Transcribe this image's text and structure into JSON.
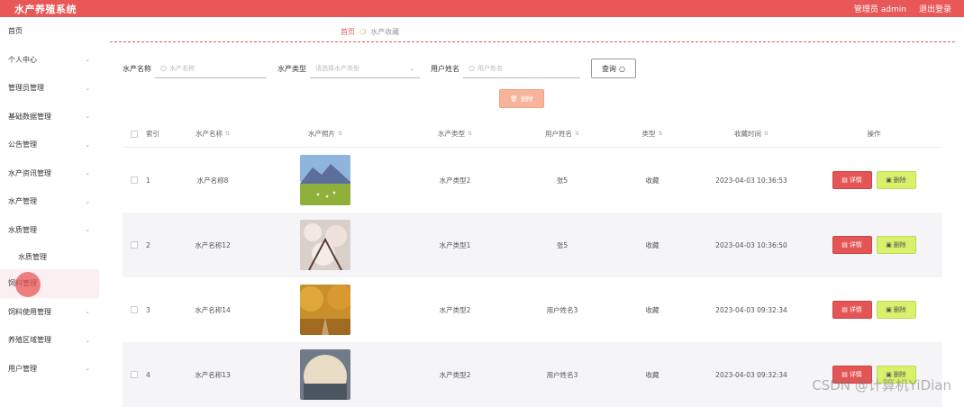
{
  "app": {
    "title": "水产养殖系统",
    "user_label": "管理员 admin",
    "logout_label": "退出登录"
  },
  "sidebar": {
    "items": [
      {
        "label": "首页",
        "chev": false
      },
      {
        "label": "个人中心",
        "chev": true
      },
      {
        "label": "管理员管理",
        "chev": true
      },
      {
        "label": "基础数据管理",
        "chev": true
      },
      {
        "label": "公告管理",
        "chev": true
      },
      {
        "label": "水产资讯管理",
        "chev": true
      },
      {
        "label": "水产管理",
        "chev": true
      },
      {
        "label": "水质管理",
        "chev": true
      },
      {
        "label": "水质管理",
        "chev": false
      },
      {
        "label": "饲料管理",
        "chev": false
      },
      {
        "label": "饲料使用管理",
        "chev": true
      },
      {
        "label": "养殖区域管理",
        "chev": true
      },
      {
        "label": "用户管理",
        "chev": true
      }
    ]
  },
  "breadcrumb": {
    "home": "首页",
    "current": "水产收藏"
  },
  "search": {
    "name_label": "水产名称",
    "name_placeholder": "水产名称",
    "type_label": "水产类型",
    "type_placeholder": "请选择水产类型",
    "user_label": "用户姓名",
    "user_placeholder": "用户姓名",
    "button_label": "查询"
  },
  "toolbar": {
    "delete_label": "删除"
  },
  "table": {
    "columns": [
      "索引",
      "水产名称",
      "水产照片",
      "水产类型",
      "用户姓名",
      "类型",
      "收藏时间",
      "操作"
    ],
    "detail_label": "详情",
    "delete_label": "删除",
    "rows": [
      {
        "index": "1",
        "name": "水产名称8",
        "type": "水产类型2",
        "user": "张5",
        "kind": "收藏",
        "time": "2023-04-03 10:36:53",
        "photo": "mountain-meadow"
      },
      {
        "index": "2",
        "name": "水产名称12",
        "type": "水产类型1",
        "user": "张5",
        "kind": "收藏",
        "time": "2023-04-03 10:36:50",
        "photo": "cherry-blossom"
      },
      {
        "index": "3",
        "name": "水产名称14",
        "type": "水产类型2",
        "user": "用户姓名3",
        "kind": "收藏",
        "time": "2023-04-03 09:32:34",
        "photo": "autumn-trees"
      },
      {
        "index": "4",
        "name": "水产名称13",
        "type": "水产类型2",
        "user": "用户姓名3",
        "kind": "收藏",
        "time": "2023-04-03 09:32:34",
        "photo": "sunset-circle"
      }
    ]
  },
  "watermark": "CSDN @计算机YiDian",
  "colors": {
    "accent": "#e85858",
    "detail": "#e45656",
    "delete": "#d7f26a",
    "bulk_delete": "#f7b49a"
  }
}
